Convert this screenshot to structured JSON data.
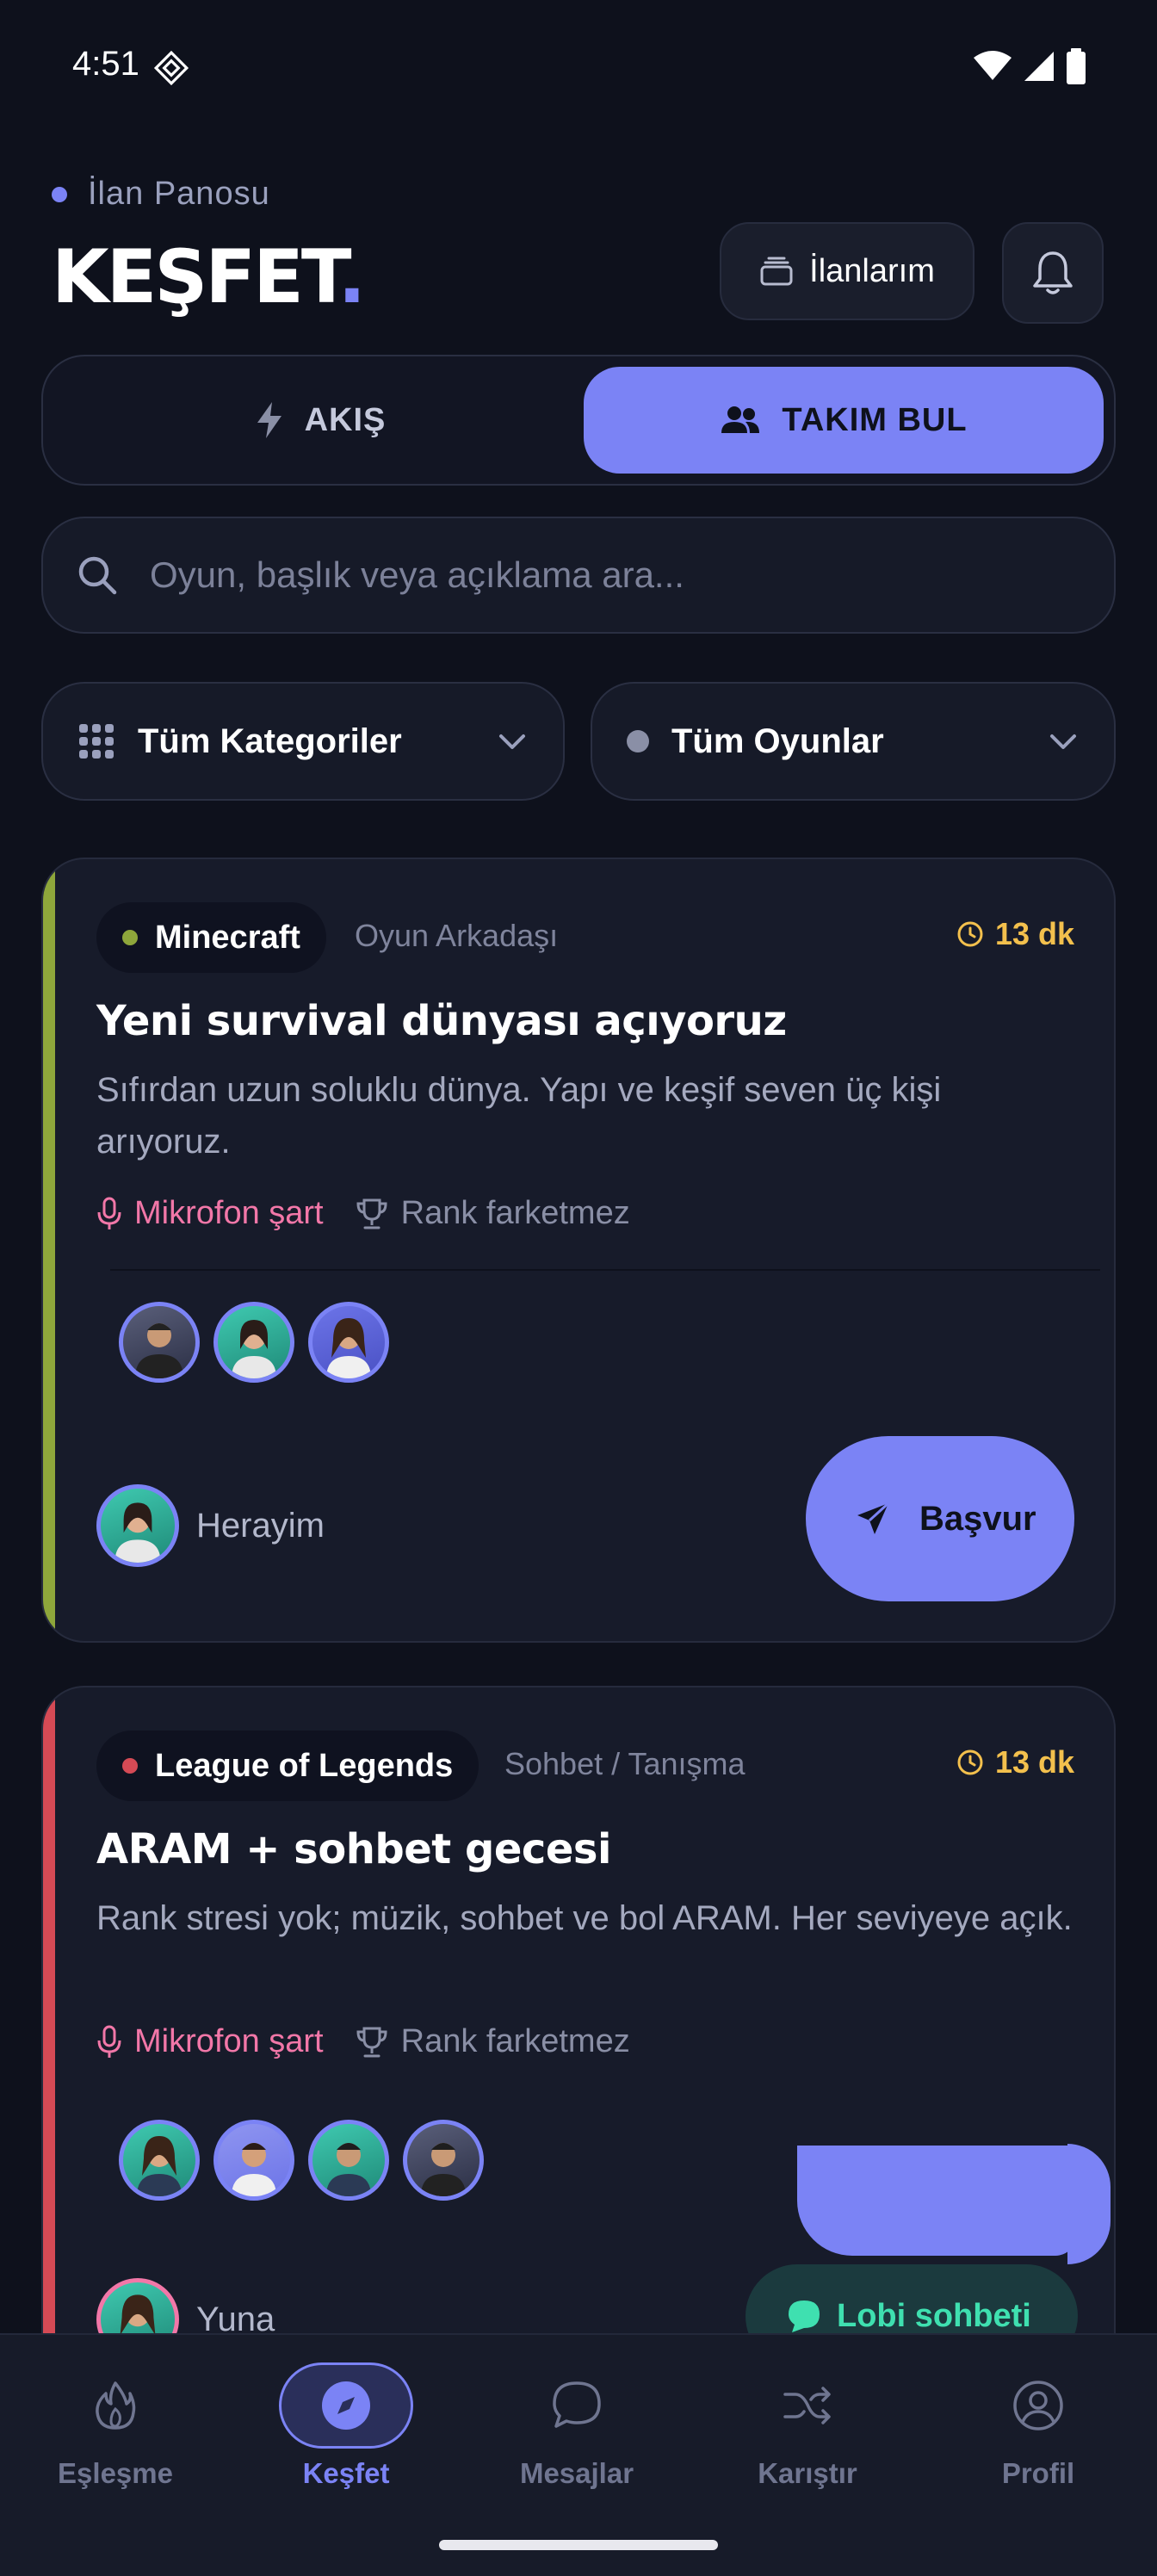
{
  "status_bar": {
    "time": "4:51"
  },
  "header": {
    "eyebrow": "İlan Panosu",
    "title": "KEŞFET",
    "title_accent": ".",
    "my_listings_label": "İlanlarım"
  },
  "tabs": [
    {
      "label": "AKIŞ",
      "active": false
    },
    {
      "label": "TAKIM BUL",
      "active": true
    }
  ],
  "search": {
    "placeholder": "Oyun, başlık veya açıklama ara...",
    "value": ""
  },
  "filters": {
    "category": "Tüm Kategoriler",
    "game": "Tüm Oyunlar"
  },
  "listings": [
    {
      "game": "Minecraft",
      "game_color": "#8ea63b",
      "type": "Oyun Arkadaşı",
      "time": "13 dk",
      "title": "Yeni survival dünyası açıyoruz",
      "description": "Sıfırdan uzun soluklu dünya. Yapı ve keşif seven üç kişi arıyoruz.",
      "mic_tag": "Mikrofon şart",
      "rank_tag": "Rank farketmez",
      "author": "Herayim",
      "apply_label": "Başvur"
    },
    {
      "game": "League of Legends",
      "game_color": "#d54a55",
      "type": "Sohbet / Tanışma",
      "time": "13 dk",
      "title": "ARAM + sohbet gecesi",
      "description": "Rank stresi yok; müzik, sohbet ve bol ARAM. Her seviyeye açık.",
      "mic_tag": "Mikrofon şart",
      "rank_tag": "Rank farketmez",
      "author": "Yuna",
      "lobby_label": "Lobi sohbeti"
    }
  ],
  "bottom_nav": [
    {
      "label": "Eşleşme",
      "icon": "flame-icon",
      "active": false
    },
    {
      "label": "Keşfet",
      "icon": "compass-icon",
      "active": true
    },
    {
      "label": "Mesajlar",
      "icon": "chat-icon",
      "active": false
    },
    {
      "label": "Karıştır",
      "icon": "shuffle-icon",
      "active": false
    },
    {
      "label": "Profil",
      "icon": "user-circle-icon",
      "active": false
    }
  ],
  "colors": {
    "accent": "#7b83f5",
    "background": "#0e111c",
    "card": "#171b2a",
    "mic_tag": "#f277a8",
    "time": "#f3c04d",
    "lobby": "#3fe0b0"
  }
}
